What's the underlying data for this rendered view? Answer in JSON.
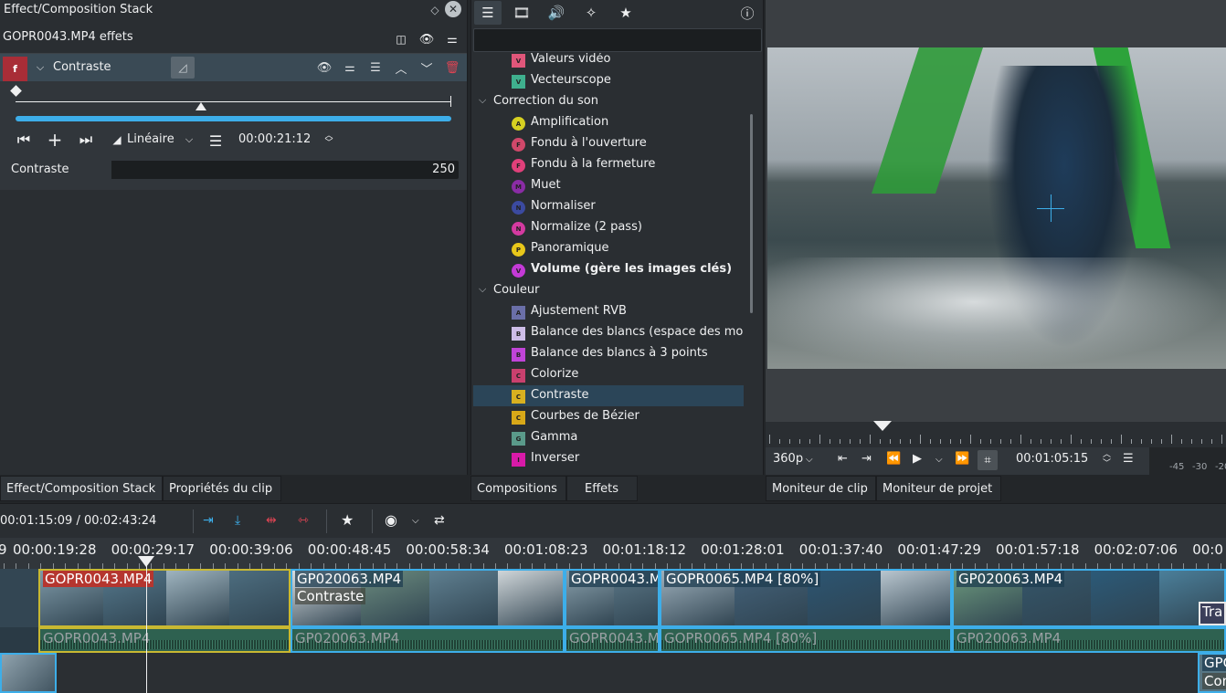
{
  "left_panel": {
    "title": "Effect/Composition Stack",
    "clip_effects_label": "GOPR0043.MP4 effets",
    "effect": {
      "badge": "f",
      "name": "Contraste",
      "interpolation": "Linéaire",
      "keyframe_time": "00:00:21:12",
      "param_label": "Contraste",
      "param_value": "250",
      "param_fraction": 0.23
    }
  },
  "effects_list": {
    "search_placeholder": "",
    "rows": [
      {
        "kind": "effect",
        "badge": "V",
        "color": "#e0567a",
        "shape": "square",
        "label": "Valeurs vidéo"
      },
      {
        "kind": "effect",
        "badge": "V",
        "color": "#3fb08e",
        "shape": "square",
        "label": "Vecteurscope"
      },
      {
        "kind": "category",
        "label": "Correction du son"
      },
      {
        "kind": "effect",
        "badge": "A",
        "color": "#d6d021",
        "shape": "round",
        "label": "Amplification"
      },
      {
        "kind": "effect",
        "badge": "F",
        "color": "#d0486a",
        "shape": "round",
        "label": "Fondu à l'ouverture"
      },
      {
        "kind": "effect",
        "badge": "F",
        "color": "#e0407a",
        "shape": "round",
        "label": "Fondu à la fermeture"
      },
      {
        "kind": "effect",
        "badge": "M",
        "color": "#8a2ca5",
        "shape": "round",
        "label": "Muet"
      },
      {
        "kind": "effect",
        "badge": "N",
        "color": "#3b4aa0",
        "shape": "round",
        "label": "Normaliser"
      },
      {
        "kind": "effect",
        "badge": "N",
        "color": "#d43aa0",
        "shape": "round",
        "label": "Normalize (2 pass)"
      },
      {
        "kind": "effect",
        "badge": "P",
        "color": "#e8c71a",
        "shape": "round",
        "label": "Panoramique"
      },
      {
        "kind": "effect",
        "badge": "V",
        "color": "#c43ad6",
        "shape": "round",
        "label": "Volume (gère les images clés)",
        "bold": true
      },
      {
        "kind": "category",
        "label": "Couleur"
      },
      {
        "kind": "effect",
        "badge": "A",
        "color": "#6a6fa8",
        "shape": "square",
        "label": "Ajustement RVB"
      },
      {
        "kind": "effect",
        "badge": "B",
        "color": "#cdbde8",
        "shape": "square",
        "label": "Balance des blancs (espace des mo"
      },
      {
        "kind": "effect",
        "badge": "B",
        "color": "#c044d8",
        "shape": "square",
        "label": "Balance des blancs à 3 points"
      },
      {
        "kind": "effect",
        "badge": "C",
        "color": "#c9406e",
        "shape": "square",
        "label": "Colorize"
      },
      {
        "kind": "effect",
        "badge": "C",
        "color": "#d8b020",
        "shape": "square",
        "label": "Contraste",
        "selected": true
      },
      {
        "kind": "effect",
        "badge": "C",
        "color": "#d8a818",
        "shape": "square",
        "label": "Courbes de Bézier"
      },
      {
        "kind": "effect",
        "badge": "G",
        "color": "#5a9a8a",
        "shape": "square",
        "label": "Gamma"
      },
      {
        "kind": "effect",
        "badge": "I",
        "color": "#d81aa8",
        "shape": "square",
        "label": "Inverser"
      }
    ]
  },
  "monitor": {
    "resolution": "360p",
    "timecode": "00:01:05:15",
    "vu_labels": [
      "-45",
      "-30",
      "-20"
    ]
  },
  "tabs": {
    "stack": "Effect/Composition Stack",
    "clip_props": "Propriétés du clip",
    "compositions": "Compositions",
    "effects": "Effets",
    "clip_monitor": "Moniteur de clip",
    "project_monitor": "Moniteur de projet"
  },
  "timeline": {
    "position": "00:01:15:09 / 00:02:43:24",
    "ruler_partial": "9",
    "ruler": [
      "00:00:19:28",
      "00:00:29:17",
      "00:00:39:06",
      "00:00:48:45",
      "00:00:58:34",
      "00:01:08:23",
      "00:01:18:12",
      "00:01:28:01",
      "00:01:37:40",
      "00:01:47:29",
      "00:01:57:18",
      "00:02:07:06",
      "00:0"
    ],
    "video_clips": [
      {
        "name": "GOPR0043.MP4",
        "sub": "",
        "red": true
      },
      {
        "name": "GP020063.MP4",
        "sub": "Contraste"
      },
      {
        "name": "GOPR0043.MP4",
        "sub": ""
      },
      {
        "name": "GOPR0065.MP4 [80%]",
        "sub": ""
      },
      {
        "name": "GP020063.MP4",
        "sub": ""
      }
    ],
    "audio_clips": [
      "GOPR0043.MP4",
      "GP020063.MP4",
      "GOPR0043.MP4",
      "GOPR0065.MP4 [80%]",
      "GP020063.MP4"
    ],
    "transition_label": "Tra",
    "v2_clip": {
      "name": "GPC",
      "sub": "Con"
    }
  }
}
